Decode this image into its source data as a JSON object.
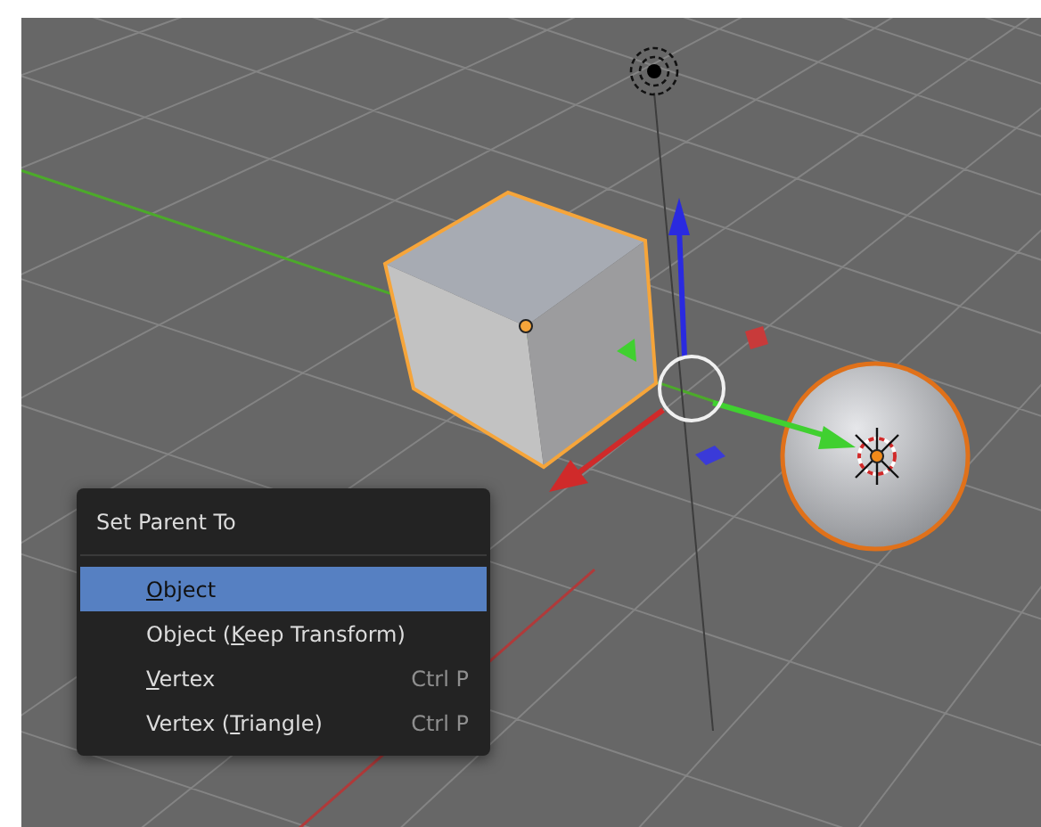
{
  "viewport": {
    "context_menu": {
      "title": "Set Parent To",
      "items": [
        {
          "parts": {
            "key": "O",
            "after": "bject"
          },
          "selected": true
        },
        {
          "parts": {
            "before": "Object (",
            "key": "K",
            "after": "eep Transform)"
          },
          "selected": false
        },
        {
          "parts": {
            "key": "V",
            "after": "ertex"
          },
          "shortcut": "Ctrl P",
          "selected": false
        },
        {
          "parts": {
            "before": "Vertex (",
            "key": "T",
            "after": "riangle)"
          },
          "shortcut": "Ctrl P",
          "selected": false
        }
      ]
    }
  }
}
